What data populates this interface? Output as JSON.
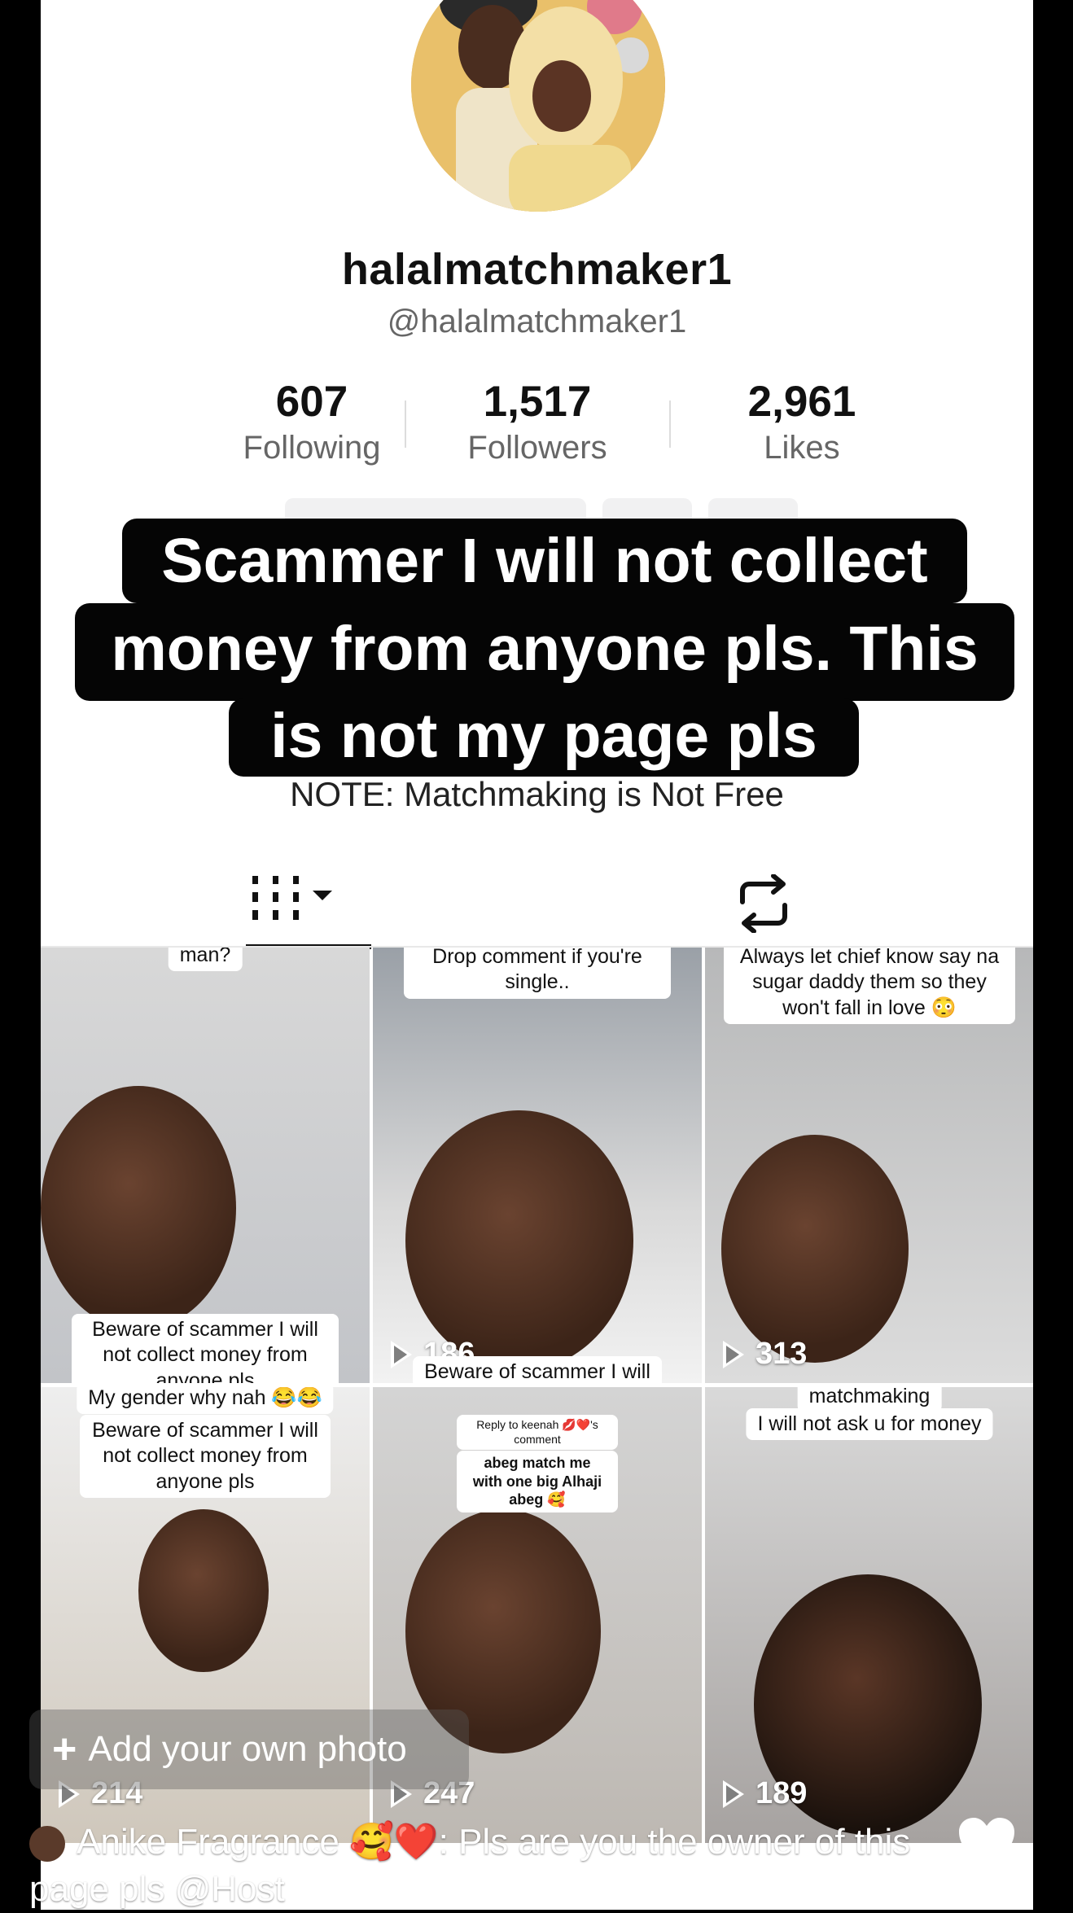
{
  "profile": {
    "display_name": "halalmatchmaker1",
    "handle": "@halalmatchmaker1",
    "stats": [
      {
        "value": "607",
        "label": "Following"
      },
      {
        "value": "1,517",
        "label": "Followers"
      },
      {
        "value": "2,961",
        "label": "Likes"
      }
    ],
    "bio": "NOTE: Matchmaking is Not Free"
  },
  "overlay_caption": {
    "line1": "Scammer I will not collect",
    "line2": "money from anyone pls. This",
    "line3": "is not my page pls"
  },
  "videos": [
    {
      "top_text": "man?",
      "caption": "Beware of scammer I will not collect money from anyone pls",
      "views": ""
    },
    {
      "top_text": "Drop comment if you're single..",
      "caption": "Beware of scammer I will",
      "views": "186"
    },
    {
      "top_text": "Always let chief know say na sugar daddy them so they won't fall in love 😳",
      "caption": "",
      "views": "313"
    },
    {
      "top_text": "My gender why nah 😂😂",
      "caption": "Beware of scammer I will not collect money from anyone pls",
      "views": "214"
    },
    {
      "top_text": "Reply to keenah 💋❤️'s comment",
      "caption": "abeg match me with one big Alhaji abeg 🥰",
      "views": "247"
    },
    {
      "top_text": "matchmaking",
      "caption": "I will not ask u for money",
      "views": "189"
    }
  ],
  "add_photo": {
    "label": "Add your own photo"
  },
  "live_comment": {
    "user": "Anike Fragrance 🥰❤️",
    "text": ": Pls are you the owner of this page pls @Host"
  },
  "like": {
    "count": "0"
  },
  "colors": {
    "caption_bg": "#050505",
    "muted": "#666666"
  }
}
